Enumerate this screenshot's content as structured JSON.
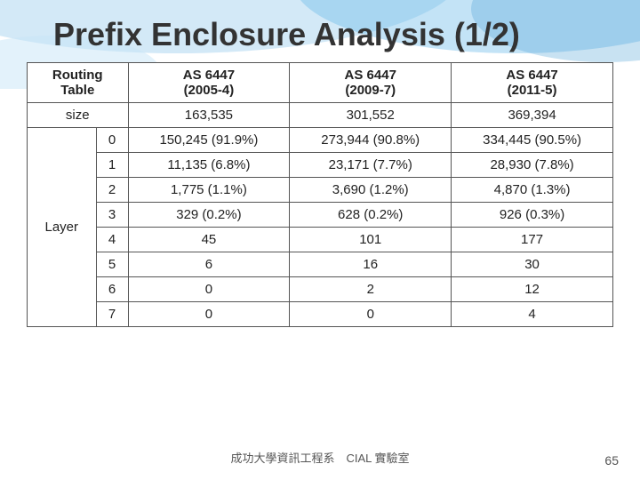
{
  "page": {
    "title": "Prefix Enclosure Analysis (1/2)",
    "footer": "成功大學資訊工程系　CIAL 實驗室",
    "page_number": "65"
  },
  "table": {
    "headers": {
      "col0_line1": "Routing",
      "col0_line2": "Table",
      "col1": "AS 6447\n(2005-4)",
      "col2": "AS 6447\n(2009-7)",
      "col3": "AS 6447\n(2011-5)"
    },
    "size_row": {
      "label": "size",
      "col1": "163,535",
      "col2": "301,552",
      "col3": "369,394"
    },
    "layer_label": "Layer",
    "rows": [
      {
        "index": "0",
        "col1": "150,245 (91.9%)",
        "col2": "273,944 (90.8%)",
        "col3": "334,445 (90.5%)"
      },
      {
        "index": "1",
        "col1": "11,135 (6.8%)",
        "col2": "23,171 (7.7%)",
        "col3": "28,930 (7.8%)"
      },
      {
        "index": "2",
        "col1": "1,775 (1.1%)",
        "col2": "3,690 (1.2%)",
        "col3": "4,870 (1.3%)"
      },
      {
        "index": "3",
        "col1": "329 (0.2%)",
        "col2": "628 (0.2%)",
        "col3": "926 (0.3%)"
      },
      {
        "index": "4",
        "col1": "45",
        "col2": "101",
        "col3": "177"
      },
      {
        "index": "5",
        "col1": "6",
        "col2": "16",
        "col3": "30"
      },
      {
        "index": "6",
        "col1": "0",
        "col2": "2",
        "col3": "12"
      },
      {
        "index": "7",
        "col1": "0",
        "col2": "0",
        "col3": "4"
      }
    ]
  }
}
